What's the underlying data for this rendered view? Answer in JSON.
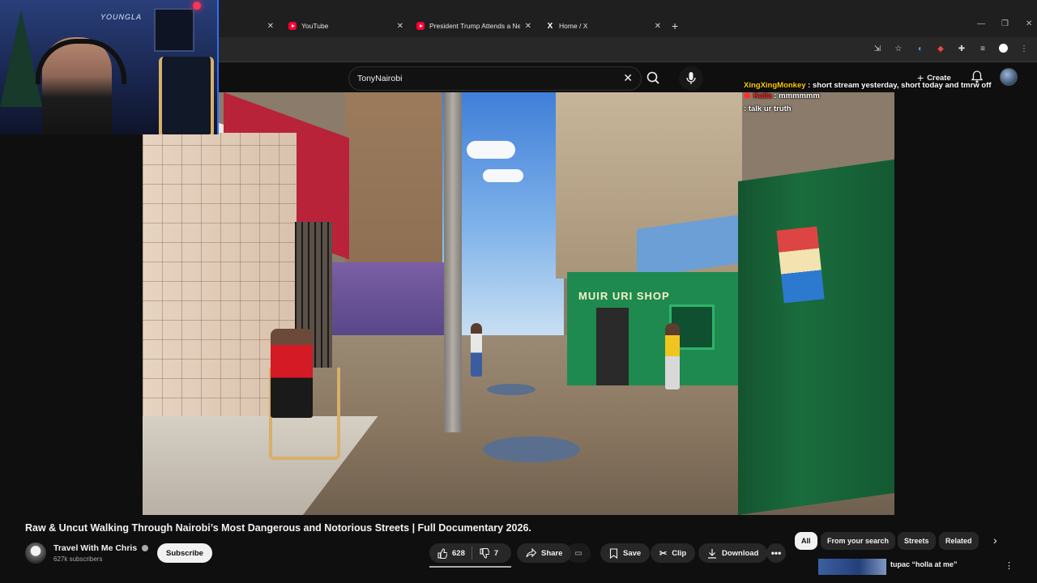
{
  "browser": {
    "tabs": [
      {
        "label": "",
        "icon": "blank"
      },
      {
        "label": "YouTube",
        "icon": "youtube-icon"
      },
      {
        "label": "President Trump Attends a New",
        "icon": "youtube-icon"
      },
      {
        "label": "Home / X",
        "icon": "x-icon"
      }
    ],
    "new_tab": "+"
  },
  "youtube": {
    "search": {
      "value": "TonyNairobi"
    },
    "create_label": "Create"
  },
  "chat": [
    {
      "user": "XingXingMonkey",
      "message": "short stream yesterday, short today and tmrw off"
    },
    {
      "user": "Kalia",
      "message": "mmmmmm"
    },
    {
      "user": "",
      "message": "talk ur truth"
    }
  ],
  "video": {
    "title": "Raw & Uncut Walking Through Nairobi’s Most Dangerous and Notorious Streets | Full Documentary 2026.",
    "channel": "Travel With Me Chris",
    "subscribers": "627k subscribers",
    "subscribe_label": "Subscribe",
    "likes": "628",
    "dislikes": "7",
    "share_label": "Share",
    "save_label": "Save",
    "clip_label": "Clip",
    "download_label": "Download",
    "scene_text": {
      "shop_sign": "MUIR URI SHOP"
    }
  },
  "recommendations": {
    "chips": [
      "All",
      "From your search",
      "Streets",
      "Related"
    ],
    "active_chip": "All",
    "first_item_title": "tupac “holla at me”"
  },
  "webcam": {
    "logo": "YOUNGLA"
  },
  "colors": {
    "accent": "#ff0033",
    "chat_user": "#ffcc00",
    "shop_green": "#1f8a4f"
  }
}
